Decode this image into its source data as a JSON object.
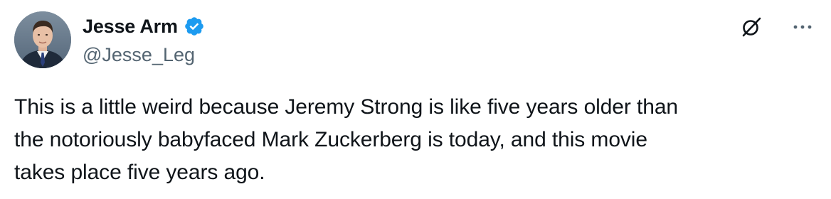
{
  "author": {
    "display_name": "Jesse Arm",
    "handle": "@Jesse_Leg",
    "verified": true
  },
  "tweet": {
    "lines": [
      "This is a little weird because Jeremy Strong is like five years older than",
      "the notoriously babyfaced Mark Zuckerberg is today, and this movie",
      "takes place five years ago."
    ]
  },
  "icons": {
    "verified": "verified-badge-icon",
    "grok": "grok-icon",
    "more": "more-options-icon"
  },
  "colors": {
    "text": "#0f1419",
    "secondary": "#536471",
    "verified_blue": "#1d9bf0"
  }
}
